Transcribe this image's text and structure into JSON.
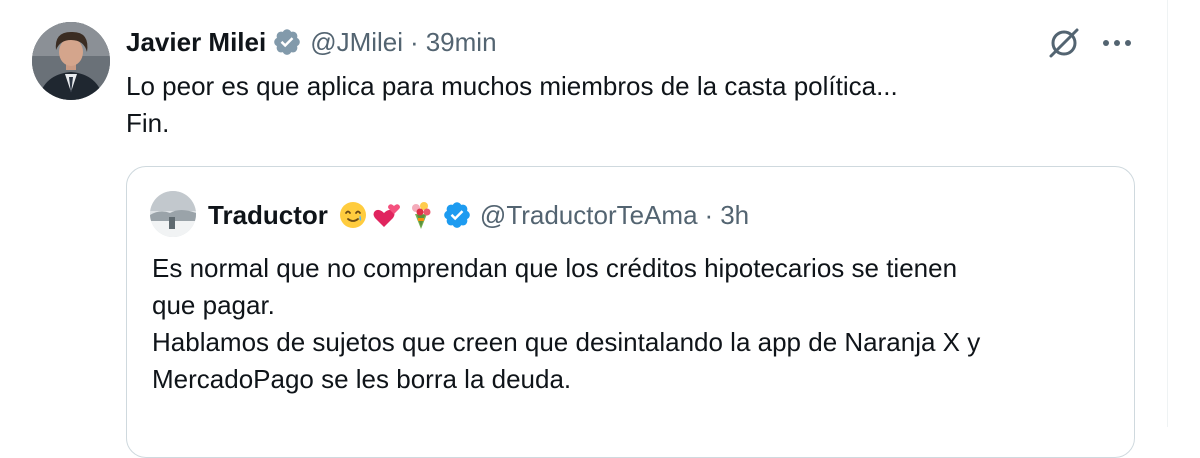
{
  "tweet": {
    "author": {
      "display_name": "Javier Milei",
      "handle": "@JMilei",
      "verified_color": "#829aab"
    },
    "separator": "·",
    "time": "39min",
    "text_lines": [
      "Lo peor es que aplica para muchos miembros de la casta política...",
      "Fin."
    ],
    "actions": {
      "grok_icon": "grok-slash-circle-icon",
      "more_icon": "more-horizontal-icon"
    }
  },
  "quote": {
    "author": {
      "display_name": "Traductor",
      "emojis": [
        "smiling-face-with-tear-icon",
        "two-hearts-icon",
        "bouquet-icon"
      ],
      "handle": "@TraductorTeAma",
      "verified_color": "#1d9bf0"
    },
    "separator": "·",
    "time": "3h",
    "text_lines": [
      "Es normal que no comprendan que los créditos hipotecarios se tienen",
      "que pagar.",
      "Hablamos de sujetos que creen que desintalando la app de Naranja X y",
      "MercadoPago se les borra la deuda."
    ]
  },
  "colors": {
    "text_primary": "#0f1419",
    "text_secondary": "#536471",
    "border": "#cfd9de"
  }
}
